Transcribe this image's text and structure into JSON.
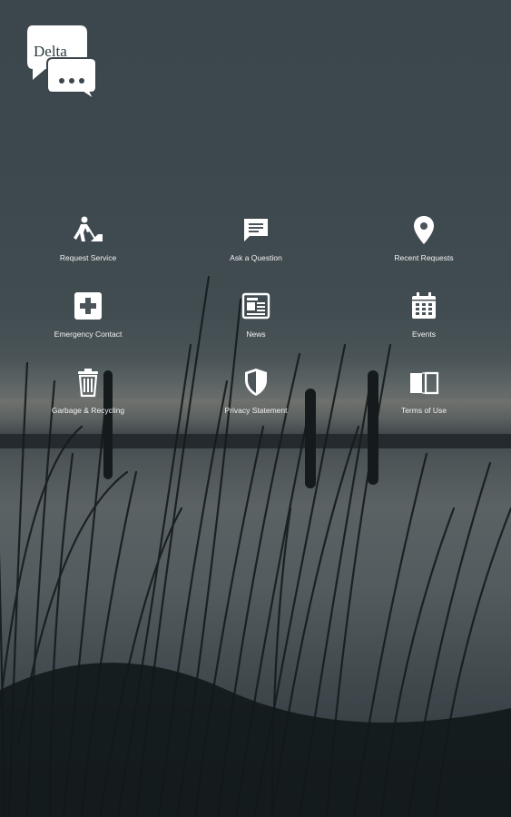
{
  "logo": {
    "text": "Delta"
  },
  "menu": [
    {
      "label": "Request Service",
      "icon": "worker-icon"
    },
    {
      "label": "Ask a Question",
      "icon": "chat-icon"
    },
    {
      "label": "Recent Requests",
      "icon": "location-pin-icon"
    },
    {
      "label": "Emergency Contact",
      "icon": "first-aid-icon"
    },
    {
      "label": "News",
      "icon": "newspaper-icon"
    },
    {
      "label": "Events",
      "icon": "calendar-icon"
    },
    {
      "label": "Garbage & Recycling",
      "icon": "trash-icon"
    },
    {
      "label": "Privacy Statement",
      "icon": "shield-icon"
    },
    {
      "label": "Terms of Use",
      "icon": "book-icon"
    }
  ]
}
